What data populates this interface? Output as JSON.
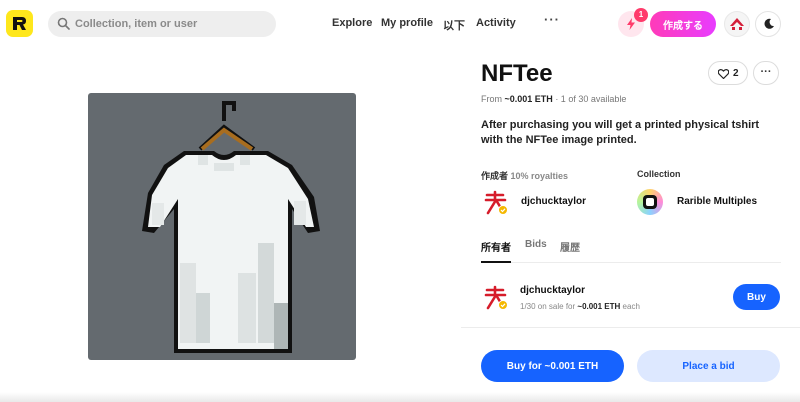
{
  "header": {
    "logo_icon": "rarible-logo-icon",
    "search_placeholder": "Collection, item or user",
    "nav": [
      "Explore",
      "My profile",
      "以下",
      "Activity"
    ],
    "more_label": "···",
    "notification_count": "1",
    "create_label": "作成する",
    "accent_yellow": "#fee71c",
    "accent_pink": "#ff3bb8"
  },
  "item": {
    "title": "NFTee",
    "likes": "2",
    "menu_label": "···",
    "price_prefix": "From",
    "price": "~0.001 ETH",
    "availability": "· 1 of 30 available",
    "description": "After purchasing you will get a printed physical tshirt with the NFTee image printed."
  },
  "creator": {
    "label": "作成者",
    "royalties": "10% royalties",
    "name": "djchucktaylor"
  },
  "collection": {
    "label": "Collection",
    "name": "Rarible Multiples"
  },
  "tabs": [
    "所有者",
    "Bids",
    "履歴"
  ],
  "owner": {
    "name": "djchucktaylor",
    "sale_prefix": "1/30 on sale for",
    "sale_price": "~0.001 ETH",
    "sale_suffix": "each",
    "buy_label": "Buy"
  },
  "actions": {
    "buy_label": "Buy for ~0.001 ETH",
    "bid_label": "Place a bid",
    "primary_color": "#1663ff"
  }
}
